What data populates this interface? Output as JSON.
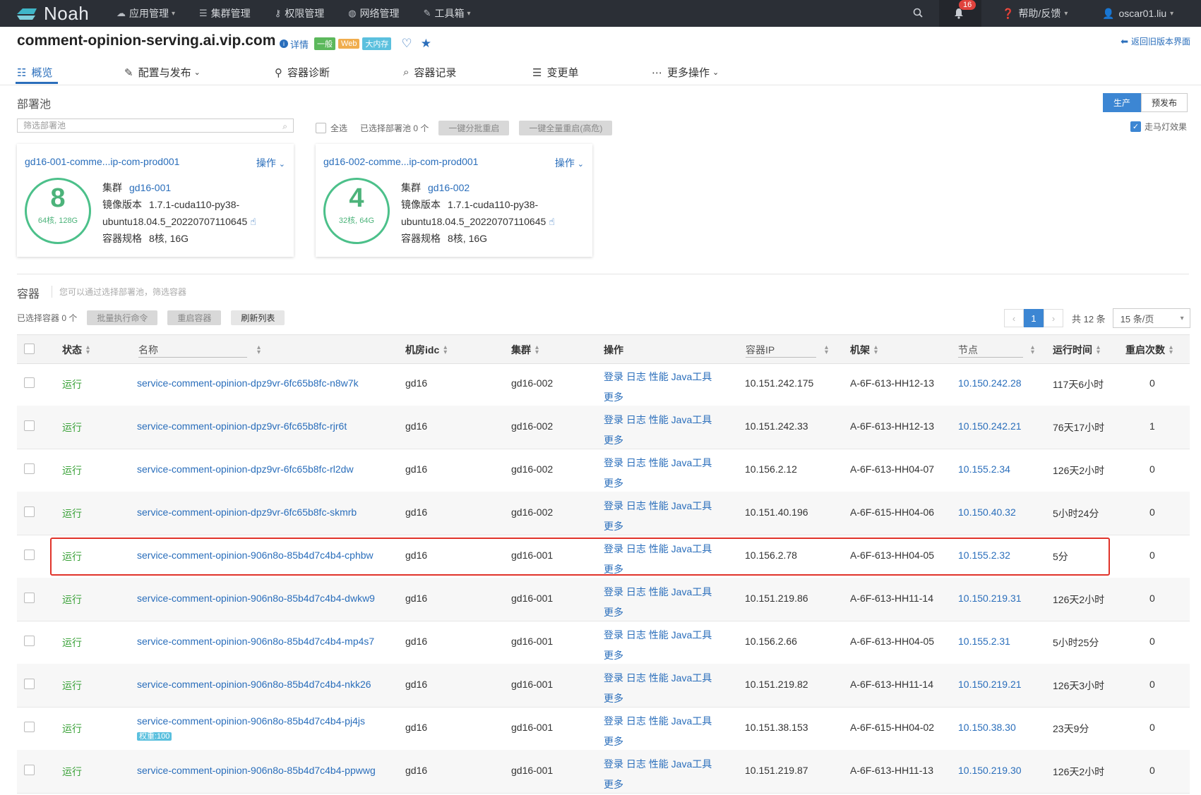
{
  "nav": {
    "logo": "Noah",
    "items": [
      {
        "label": "应用管理",
        "icon": "cloud-icon",
        "caret": true
      },
      {
        "label": "集群管理",
        "icon": "server-icon",
        "caret": false
      },
      {
        "label": "权限管理",
        "icon": "key-icon",
        "caret": false
      },
      {
        "label": "网络管理",
        "icon": "globe-icon",
        "caret": false
      },
      {
        "label": "工具箱",
        "icon": "wrench-icon",
        "caret": true
      }
    ],
    "notification_count": "16",
    "help": "帮助/反馈",
    "user": "oscar01.liu"
  },
  "header": {
    "title": "comment-opinion-serving.ai.vip.com",
    "detail": "详情",
    "tags": [
      "一般",
      "Web",
      "大内存"
    ],
    "back_link": "返回旧版本界面"
  },
  "tabs": [
    "概览",
    "配置与发布",
    "容器诊断",
    "容器记录",
    "变更单",
    "更多操作"
  ],
  "deploy": {
    "title": "部署池",
    "env_buttons": [
      "生产",
      "预发布"
    ],
    "filter_placeholder": "筛选部署池",
    "select_all": "全选",
    "selected_count": "已选择部署池 0 个",
    "batch_restart": "一键分批重启",
    "full_restart": "一键全量重启(高危)",
    "marquee": "走马灯效果",
    "pools": [
      {
        "name": "gd16-001-comme...ip-com-prod001",
        "op": "操作",
        "count": "8",
        "spec": "64核, 128G",
        "cluster_label": "集群",
        "cluster": "gd16-001",
        "image_label": "镜像版本",
        "image_line1": "1.7.1-cuda110-py38-",
        "image_line2": "ubuntu18.04.5_20220707110645",
        "size_label": "容器规格",
        "size": "8核, 16G"
      },
      {
        "name": "gd16-002-comme...ip-com-prod001",
        "op": "操作",
        "count": "4",
        "spec": "32核, 64G",
        "cluster_label": "集群",
        "cluster": "gd16-002",
        "image_label": "镜像版本",
        "image_line1": "1.7.1-cuda110-py38-",
        "image_line2": "ubuntu18.04.5_20220707110645",
        "size_label": "容器规格",
        "size": "8核, 16G"
      }
    ]
  },
  "containers": {
    "title": "容器",
    "hint": "您可以通过选择部署池，筛选容器",
    "selected": "已选择容器 0 个",
    "buttons": [
      "批量执行命令",
      "重启容器",
      "刷新列表"
    ],
    "page": "1",
    "total": "共 12 条",
    "page_size": "15 条/页",
    "columns": [
      "状态",
      "名称",
      "机房idc",
      "集群",
      "操作",
      "容器IP",
      "机架",
      "节点",
      "运行时间",
      "重启次数"
    ],
    "ops": [
      "登录",
      "日志",
      "性能",
      "Java工具",
      "更多"
    ],
    "rows": [
      {
        "status": "运行",
        "name": "service-comment-opinion-dpz9vr-6fc65b8fc-n8w7k",
        "idc": "gd16",
        "cluster": "gd16-002",
        "ip": "10.151.242.175",
        "rack": "A-6F-613-HH12-13",
        "node": "10.150.242.28",
        "uptime": "117天6小时",
        "restarts": "0"
      },
      {
        "status": "运行",
        "name": "service-comment-opinion-dpz9vr-6fc65b8fc-rjr6t",
        "idc": "gd16",
        "cluster": "gd16-002",
        "ip": "10.151.242.33",
        "rack": "A-6F-613-HH12-13",
        "node": "10.150.242.21",
        "uptime": "76天17小时",
        "restarts": "1"
      },
      {
        "status": "运行",
        "name": "service-comment-opinion-dpz9vr-6fc65b8fc-rl2dw",
        "idc": "gd16",
        "cluster": "gd16-002",
        "ip": "10.156.2.12",
        "rack": "A-6F-613-HH04-07",
        "node": "10.155.2.34",
        "uptime": "126天2小时",
        "restarts": "0"
      },
      {
        "status": "运行",
        "name": "service-comment-opinion-dpz9vr-6fc65b8fc-skmrb",
        "idc": "gd16",
        "cluster": "gd16-002",
        "ip": "10.151.40.196",
        "rack": "A-6F-615-HH04-06",
        "node": "10.150.40.32",
        "uptime": "5小时24分",
        "restarts": "0"
      },
      {
        "status": "运行",
        "name": "service-comment-opinion-906n8o-85b4d7c4b4-cphbw",
        "idc": "gd16",
        "cluster": "gd16-001",
        "ip": "10.156.2.78",
        "rack": "A-6F-613-HH04-05",
        "node": "10.155.2.32",
        "uptime": "5分",
        "restarts": "0"
      },
      {
        "status": "运行",
        "name": "service-comment-opinion-906n8o-85b4d7c4b4-dwkw9",
        "idc": "gd16",
        "cluster": "gd16-001",
        "ip": "10.151.219.86",
        "rack": "A-6F-613-HH11-14",
        "node": "10.150.219.31",
        "uptime": "126天2小时",
        "restarts": "0"
      },
      {
        "status": "运行",
        "name": "service-comment-opinion-906n8o-85b4d7c4b4-mp4s7",
        "idc": "gd16",
        "cluster": "gd16-001",
        "ip": "10.156.2.66",
        "rack": "A-6F-613-HH04-05",
        "node": "10.155.2.31",
        "uptime": "5小时25分",
        "restarts": "0"
      },
      {
        "status": "运行",
        "name": "service-comment-opinion-906n8o-85b4d7c4b4-nkk26",
        "idc": "gd16",
        "cluster": "gd16-001",
        "ip": "10.151.219.82",
        "rack": "A-6F-613-HH11-14",
        "node": "10.150.219.21",
        "uptime": "126天3小时",
        "restarts": "0"
      },
      {
        "status": "运行",
        "name": "service-comment-opinion-906n8o-85b4d7c4b4-pj4js",
        "weight": "权重:100",
        "idc": "gd16",
        "cluster": "gd16-001",
        "ip": "10.151.38.153",
        "rack": "A-6F-615-HH04-02",
        "node": "10.150.38.30",
        "uptime": "23天9分",
        "restarts": "0"
      },
      {
        "status": "运行",
        "name": "service-comment-opinion-906n8o-85b4d7c4b4-ppwwg",
        "idc": "gd16",
        "cluster": "gd16-001",
        "ip": "10.151.219.87",
        "rack": "A-6F-613-HH11-13",
        "node": "10.150.219.30",
        "uptime": "126天2小时",
        "restarts": "0"
      }
    ]
  }
}
